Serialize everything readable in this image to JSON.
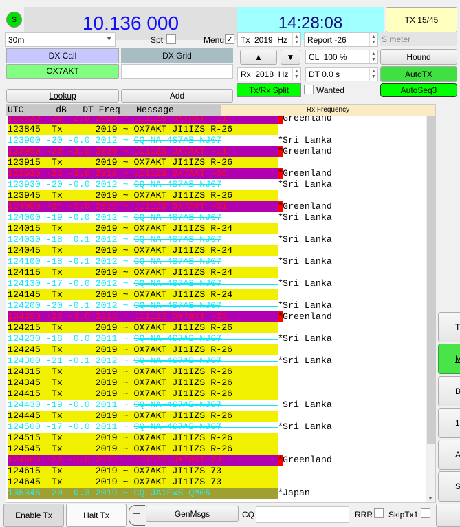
{
  "status_led": {
    "label": "S",
    "color": "#00e000"
  },
  "frequency": "10.136 000",
  "clock": "14:28:08",
  "tx_period": "TX 15/45",
  "band": "30m",
  "spt_label": "Spt",
  "spt_checked": false,
  "menu_label": "Menu",
  "menu_checked": true,
  "tx_freq": "Tx  2019  Hz",
  "rx_freq": "Rx  2018  Hz",
  "report": "Report -26",
  "s_meter": "S meter",
  "cl": "CL  100 %",
  "dt": "DT 0.0 s",
  "hound": "Hound",
  "autotx": "AutoTX",
  "autoseq": "AutoSeq3",
  "split": "Tx/Rx Split",
  "wanted": "Wanted",
  "dx_call_label": "DX Call",
  "dx_grid_label": "DX Grid",
  "dx_call": "OX7AKT",
  "dx_grid": "",
  "lookup": "Lookup",
  "add": "Add",
  "up": "▲",
  "down": "▼",
  "list_header": {
    "cols": "UTC      dB   DT Freq   Message",
    "rx_frequency": "Rx Frequency"
  },
  "rows": [
    {
      "type": "rx",
      "pre": "123830 -26 -2.9 2020 ~ ",
      "msg": "JI1IZS OX7AKT -11",
      "country": "Greenland",
      "star": "*"
    },
    {
      "type": "tx",
      "pre": "123845  Tx      2019 ~ ",
      "msg": "OX7AKT JI1IZS R-26",
      "country": "",
      "star": ""
    },
    {
      "type": "cq",
      "pre": "123900 -20 -0.0 2012 ~ ",
      "msg": "CQ NA 4S7AB NJ07",
      "country": "Sri Lanka",
      "star": "*"
    },
    {
      "type": "rx",
      "pre": "123900 -26 -3.0 2020 ~ ",
      "msg": "JI1IZS OX7AKT -11",
      "country": "Greenland",
      "star": "*"
    },
    {
      "type": "tx",
      "pre": "123915  Tx      2019 ~ ",
      "msg": "OX7AKT JI1IZS R-26",
      "country": "",
      "star": ""
    },
    {
      "type": "rx",
      "pre": "123930 -26 -3.0 2019 ~ ",
      "msg": "JI1IZS OX7AKT -06",
      "country": "Greenland",
      "star": "*"
    },
    {
      "type": "cq",
      "pre": "123930 -20 -0.0 2012 ~ ",
      "msg": "CQ NA 4S7AB NJ07",
      "country": "Sri Lanka",
      "star": "*"
    },
    {
      "type": "tx",
      "pre": "123945  Tx      2019 ~ ",
      "msg": "OX7AKT JI1IZS R-26",
      "country": "",
      "star": ""
    },
    {
      "type": "rx",
      "pre": "124000 -24 -3.0 2018 ~ ",
      "msg": "JI1IZS OX7AKT -01",
      "country": "Greenland",
      "star": "*"
    },
    {
      "type": "cq",
      "pre": "124000 -19 -0.0 2012 ~ ",
      "msg": "CQ NA 4S7AB NJ07",
      "country": "Sri Lanka",
      "star": "*"
    },
    {
      "type": "tx",
      "pre": "124015  Tx      2019 ~ ",
      "msg": "OX7AKT JI1IZS R-24",
      "country": "",
      "star": ""
    },
    {
      "type": "cq",
      "pre": "124030 -18  0.1 2012 ~ ",
      "msg": "CQ NA 4S7AB NJ07",
      "country": "Sri Lanka",
      "star": "*"
    },
    {
      "type": "tx",
      "pre": "124045  Tx      2019 ~ ",
      "msg": "OX7AKT JI1IZS R-24",
      "country": "",
      "star": ""
    },
    {
      "type": "cq",
      "pre": "124100 -18 -0.1 2012 ~ ",
      "msg": "CQ NA 4S7AB NJ07",
      "country": "Sri Lanka",
      "star": "*"
    },
    {
      "type": "tx",
      "pre": "124115  Tx      2019 ~ ",
      "msg": "OX7AKT JI1IZS R-24",
      "country": "",
      "star": ""
    },
    {
      "type": "cq",
      "pre": "124130 -17 -0.0 2012 ~ ",
      "msg": "CQ NA 4S7AB NJ07",
      "country": "Sri Lanka",
      "star": "*"
    },
    {
      "type": "tx",
      "pre": "124145  Tx      2019 ~ ",
      "msg": "OX7AKT JI1IZS R-24",
      "country": "",
      "star": ""
    },
    {
      "type": "cq",
      "pre": "124200 -20 -0.1 2012 ~ ",
      "msg": "CQ NA 4S7AB NJ07",
      "country": "Sri Lanka",
      "star": "*"
    },
    {
      "type": "rx",
      "pre": "124200 -26 -3.0 2018 ~ ",
      "msg": "JI1IZS OX7AKT -23",
      "country": "Greenland",
      "star": "*"
    },
    {
      "type": "tx",
      "pre": "124215  Tx      2019 ~ ",
      "msg": "OX7AKT JI1IZS R-26",
      "country": "",
      "star": ""
    },
    {
      "type": "cq",
      "pre": "124230 -18  0.0 2011 ~ ",
      "msg": "CQ NA 4S7AB NJ07",
      "country": "Sri Lanka",
      "star": "*"
    },
    {
      "type": "tx",
      "pre": "124245  Tx      2019 ~ ",
      "msg": "OX7AKT JI1IZS R-26",
      "country": "",
      "star": ""
    },
    {
      "type": "cq",
      "pre": "124300 -21 -0.1 2012 ~ ",
      "msg": "CQ NA 4S7AB NJ07",
      "country": "Sri Lanka",
      "star": "*"
    },
    {
      "type": "tx",
      "pre": "124315  Tx      2019 ~ ",
      "msg": "OX7AKT JI1IZS R-26",
      "country": "",
      "star": ""
    },
    {
      "type": "tx",
      "pre": "124345  Tx      2019 ~ ",
      "msg": "OX7AKT JI1IZS R-26",
      "country": "",
      "star": ""
    },
    {
      "type": "tx",
      "pre": "124415  Tx      2019 ~ ",
      "msg": "OX7AKT JI1IZS R-26",
      "country": "",
      "star": ""
    },
    {
      "type": "cq",
      "pre": "124430 -19 -0.0 2011 ~ ",
      "msg": "CQ NA 4S7AB NJ07",
      "country": "Sri Lanka",
      "star": " "
    },
    {
      "type": "tx",
      "pre": "124445  Tx      2019 ~ ",
      "msg": "OX7AKT JI1IZS R-26",
      "country": "",
      "star": ""
    },
    {
      "type": "cq",
      "pre": "124500 -17 -0.0 2011 ~ ",
      "msg": "CQ NA 4S7AB NJ07",
      "country": "Sri Lanka",
      "star": "*"
    },
    {
      "type": "tx",
      "pre": "124515  Tx      2019 ~ ",
      "msg": "OX7AKT JI1IZS R-26",
      "country": "",
      "star": ""
    },
    {
      "type": "tx",
      "pre": "124545  Tx      2019 ~ ",
      "msg": "OX7AKT JI1IZS R-26",
      "country": "",
      "star": ""
    },
    {
      "type": "rx",
      "pre": "124600 -26 -3.0 2018 ~ ",
      "msg": "JI1IZS OX7AKT 73",
      "country": "Greenland",
      "star": "*"
    },
    {
      "type": "tx",
      "pre": "124615  Tx      2019 ~ ",
      "msg": "OX7AKT JI1IZS 73",
      "country": "",
      "star": ""
    },
    {
      "type": "tx",
      "pre": "124645  Tx      2019 ~ ",
      "msg": "OX7AKT JI1IZS 73",
      "country": "",
      "star": ""
    },
    {
      "type": "jp",
      "pre": "135345 -20  0.3 2019 ~ ",
      "msg": "CQ JA1FWS QM05",
      "country": "Japan",
      "star": "*"
    }
  ],
  "side_buttons": [
    "T",
    "Mo",
    "By",
    "1",
    "Ar",
    "S"
  ],
  "bottom": {
    "enable_tx": "Enable Tx",
    "halt_tx": "Halt Tx",
    "genmsgs": "GenMsgs",
    "cq_label": "CQ",
    "cq_value": "",
    "rrr": "RRR",
    "skiptx1": "SkipTx1"
  },
  "colors": {
    "rx_bg": "#b000b0",
    "rx_text": "#ff1010",
    "tx_bg": "#f0f000",
    "cq_text": "#10e8f8",
    "green": "#00ff00"
  }
}
